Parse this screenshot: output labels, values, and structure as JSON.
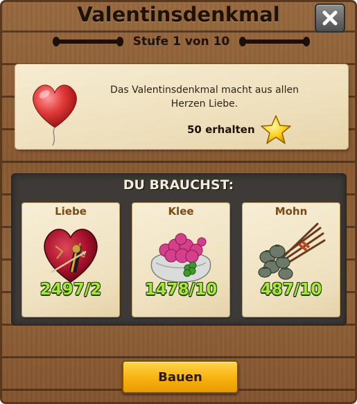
{
  "dialog": {
    "title": "Valentinsdenkmal",
    "subtitle": "Stufe 1 von 10",
    "close_icon": "close-x-icon"
  },
  "info": {
    "description": "Das Valentinsdenkmal macht aus allen Herzen Liebe.",
    "reward_text": "50 erhalten",
    "reward_icon": "star-icon",
    "image": "heart-balloon-icon"
  },
  "needs": {
    "title": "DU BRAUCHST:",
    "items": [
      {
        "label": "Liebe",
        "count": "2497/2",
        "icon": "love-heart-icon"
      },
      {
        "label": "Klee",
        "count": "1478/10",
        "icon": "clover-sack-icon"
      },
      {
        "label": "Mohn",
        "count": "487/10",
        "icon": "poppy-bundle-icon"
      }
    ]
  },
  "actions": {
    "build_label": "Bauen"
  },
  "colors": {
    "wood": "#8a5a32",
    "parchment": "#f3e8cc",
    "panel": "#3e3a37",
    "count_green": "#a9e63a",
    "button_yellow": "#f7b20e",
    "label_brown": "#7a4a16"
  }
}
